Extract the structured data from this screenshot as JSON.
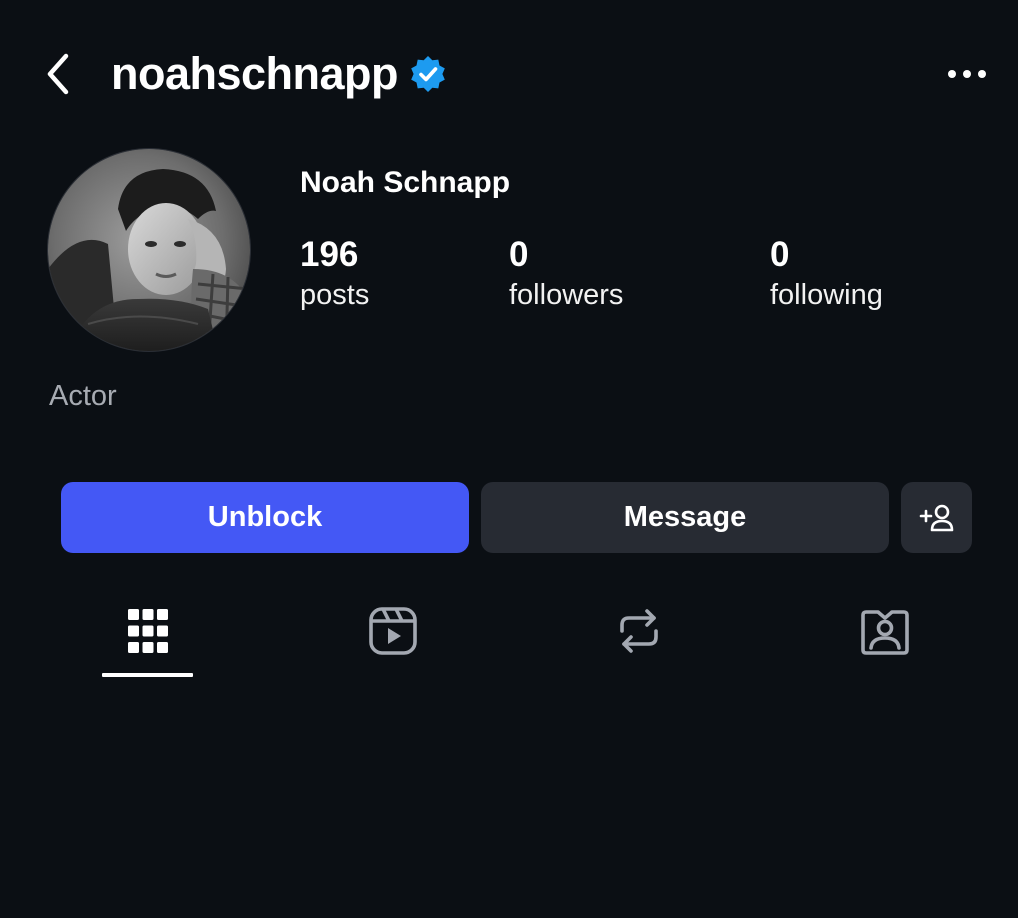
{
  "header": {
    "username": "noahschnapp",
    "back_icon": "chevron-left-icon",
    "verified_icon": "verified-badge-icon",
    "more_icon": "more-horizontal-icon",
    "verified_color": "#1d9bf0"
  },
  "profile": {
    "display_name": "Noah Schnapp",
    "bio": "Actor",
    "stats": {
      "posts": {
        "value": "196",
        "label": "posts"
      },
      "followers": {
        "value": "0",
        "label": "followers"
      },
      "following": {
        "value": "0",
        "label": "following"
      }
    }
  },
  "actions": {
    "unblock_label": "Unblock",
    "message_label": "Message",
    "add_person_icon": "add-person-icon",
    "accent_color": "#4458f5"
  },
  "tabs": [
    {
      "name": "posts-grid",
      "icon": "grid-icon",
      "active": true
    },
    {
      "name": "reels",
      "icon": "reels-icon",
      "active": false
    },
    {
      "name": "reposts",
      "icon": "repost-icon",
      "active": false
    },
    {
      "name": "tagged",
      "icon": "tagged-person-icon",
      "active": false
    }
  ],
  "colors": {
    "background": "#0b0f14",
    "secondary_button": "#272b33"
  }
}
